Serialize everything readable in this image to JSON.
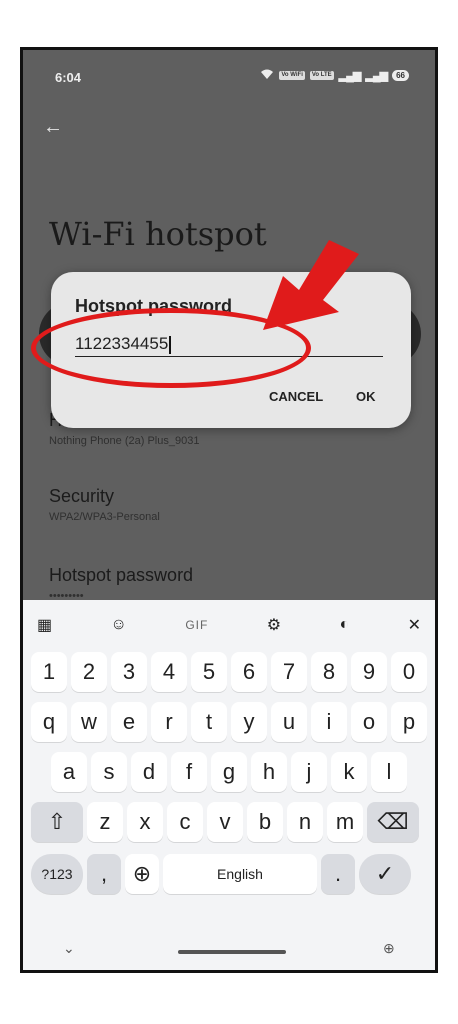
{
  "status_bar": {
    "time": "6:04",
    "chips": [
      "Vo WiFi",
      "Vo LTE"
    ],
    "battery": "66"
  },
  "screen": {
    "title": "Wi-Fi hotspot"
  },
  "settings": [
    {
      "label": "H",
      "value": "Nothing Phone (2a) Plus_9031"
    },
    {
      "label": "Security",
      "value": "WPA2/WPA3-Personal"
    },
    {
      "label": "Hotspot password",
      "value": "•••••••••"
    }
  ],
  "dialog": {
    "title": "Hotspot password",
    "value": "1122334455",
    "cancel": "CANCEL",
    "ok": "OK"
  },
  "keyboard": {
    "toolbar": {
      "gif": "GIF"
    },
    "number_row": [
      "1",
      "2",
      "3",
      "4",
      "5",
      "6",
      "7",
      "8",
      "9",
      "0"
    ],
    "row1": [
      "q",
      "w",
      "e",
      "r",
      "t",
      "y",
      "u",
      "i",
      "o",
      "p"
    ],
    "row2": [
      "a",
      "s",
      "d",
      "f",
      "g",
      "h",
      "j",
      "k",
      "l"
    ],
    "row3": [
      "z",
      "x",
      "c",
      "v",
      "b",
      "n",
      "m"
    ],
    "bottom": {
      "symbols": "?123",
      "comma": ",",
      "space": "English",
      "period": "."
    }
  },
  "colors": {
    "accent_annotation": "#e01b1b"
  }
}
